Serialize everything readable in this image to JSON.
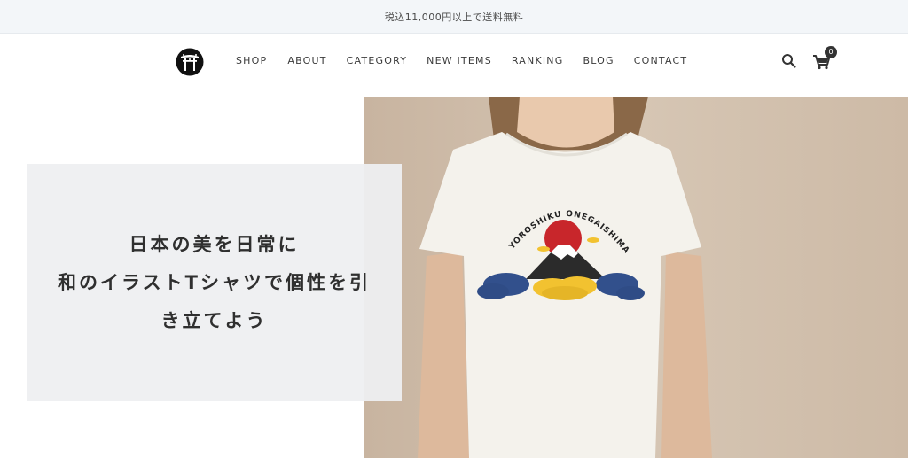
{
  "announcement": {
    "text": "税込11,000円以上で送料無料"
  },
  "header": {
    "nav": [
      {
        "label": "SHOP"
      },
      {
        "label": "ABOUT"
      },
      {
        "label": "CATEGORY"
      },
      {
        "label": "NEW ITEMS"
      },
      {
        "label": "RANKING"
      },
      {
        "label": "BLOG"
      },
      {
        "label": "CONTACT"
      }
    ],
    "cart_count": "0",
    "icons": {
      "logo": "torii-gate-logo",
      "search": "search-icon",
      "cart": "cart-icon"
    }
  },
  "hero": {
    "lines": [
      "日本の美を日常に",
      "和のイラストTシャツで個性を引",
      "き立てよう"
    ],
    "shirt_print_text": "YOROSHIKU ONEGAISHIMASU"
  },
  "colors": {
    "announce_bg": "#f3f6f9",
    "photo_bg": "#d4c3b1",
    "text_box_bg": "#eeeff1",
    "sun_red": "#c8262b",
    "cloud_blue": "#32508c",
    "cloud_gold": "#f2c230"
  }
}
